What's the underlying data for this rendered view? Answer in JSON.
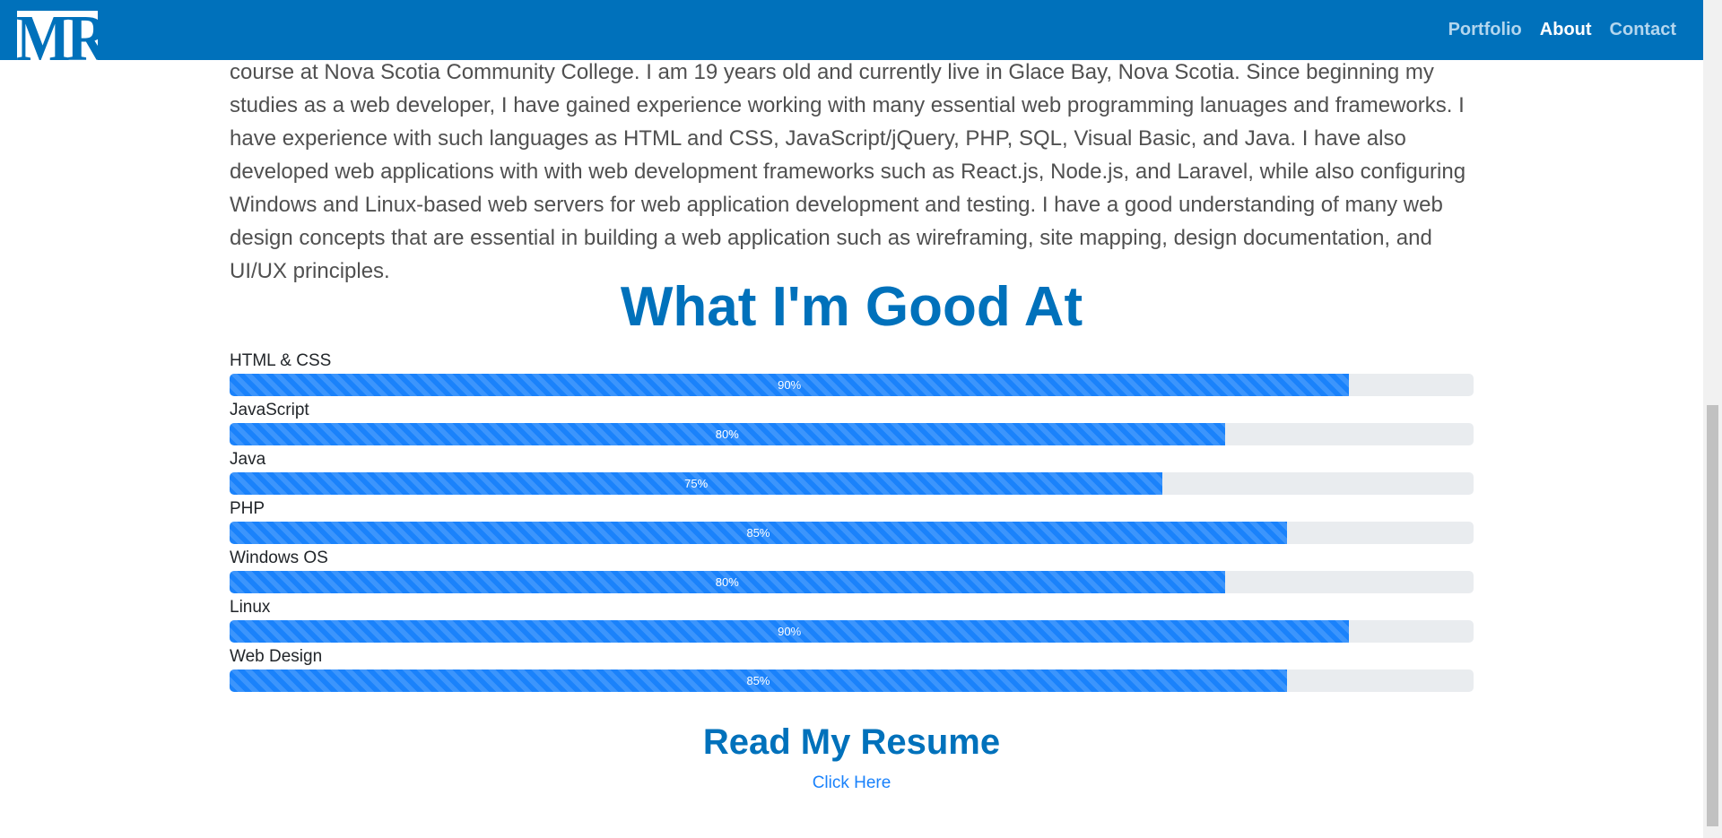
{
  "header": {
    "logo_text": "MR",
    "nav": [
      {
        "label": "Portfolio",
        "active": false
      },
      {
        "label": "About",
        "active": true
      },
      {
        "label": "Contact",
        "active": false
      }
    ]
  },
  "about": {
    "paragraph": "course at Nova Scotia Community College. I am 19 years old and currently live in Glace Bay, Nova Scotia. Since beginning my studies as a web developer, I have gained experience working with many essential web programming lanuages and frameworks. I have experience with such languages as HTML and CSS, JavaScript/jQuery, PHP, SQL, Visual Basic, and Java. I have also developed web applications with with web development frameworks such as React.js, Node.js, and Laravel, while also configuring Windows and Linux-based web servers for web application development and testing. I have a good understanding of many web design concepts that are essential in building a web application such as wireframing, site mapping, design documentation, and UI/UX principles."
  },
  "skills_section": {
    "title": "What I'm Good At",
    "skills": [
      {
        "name": "HTML & CSS",
        "percent": 90,
        "label": "90%"
      },
      {
        "name": "JavaScript",
        "percent": 80,
        "label": "80%"
      },
      {
        "name": "Java",
        "percent": 75,
        "label": "75%"
      },
      {
        "name": "PHP",
        "percent": 85,
        "label": "85%"
      },
      {
        "name": "Windows OS",
        "percent": 80,
        "label": "80%"
      },
      {
        "name": "Linux",
        "percent": 90,
        "label": "90%"
      },
      {
        "name": "Web Design",
        "percent": 85,
        "label": "85%"
      }
    ]
  },
  "resume": {
    "title": "Read My Resume",
    "link_label": "Click Here"
  },
  "colors": {
    "brand": "#0071bb",
    "progress_bar": "#1a82fb",
    "progress_track": "#e9ecef"
  }
}
